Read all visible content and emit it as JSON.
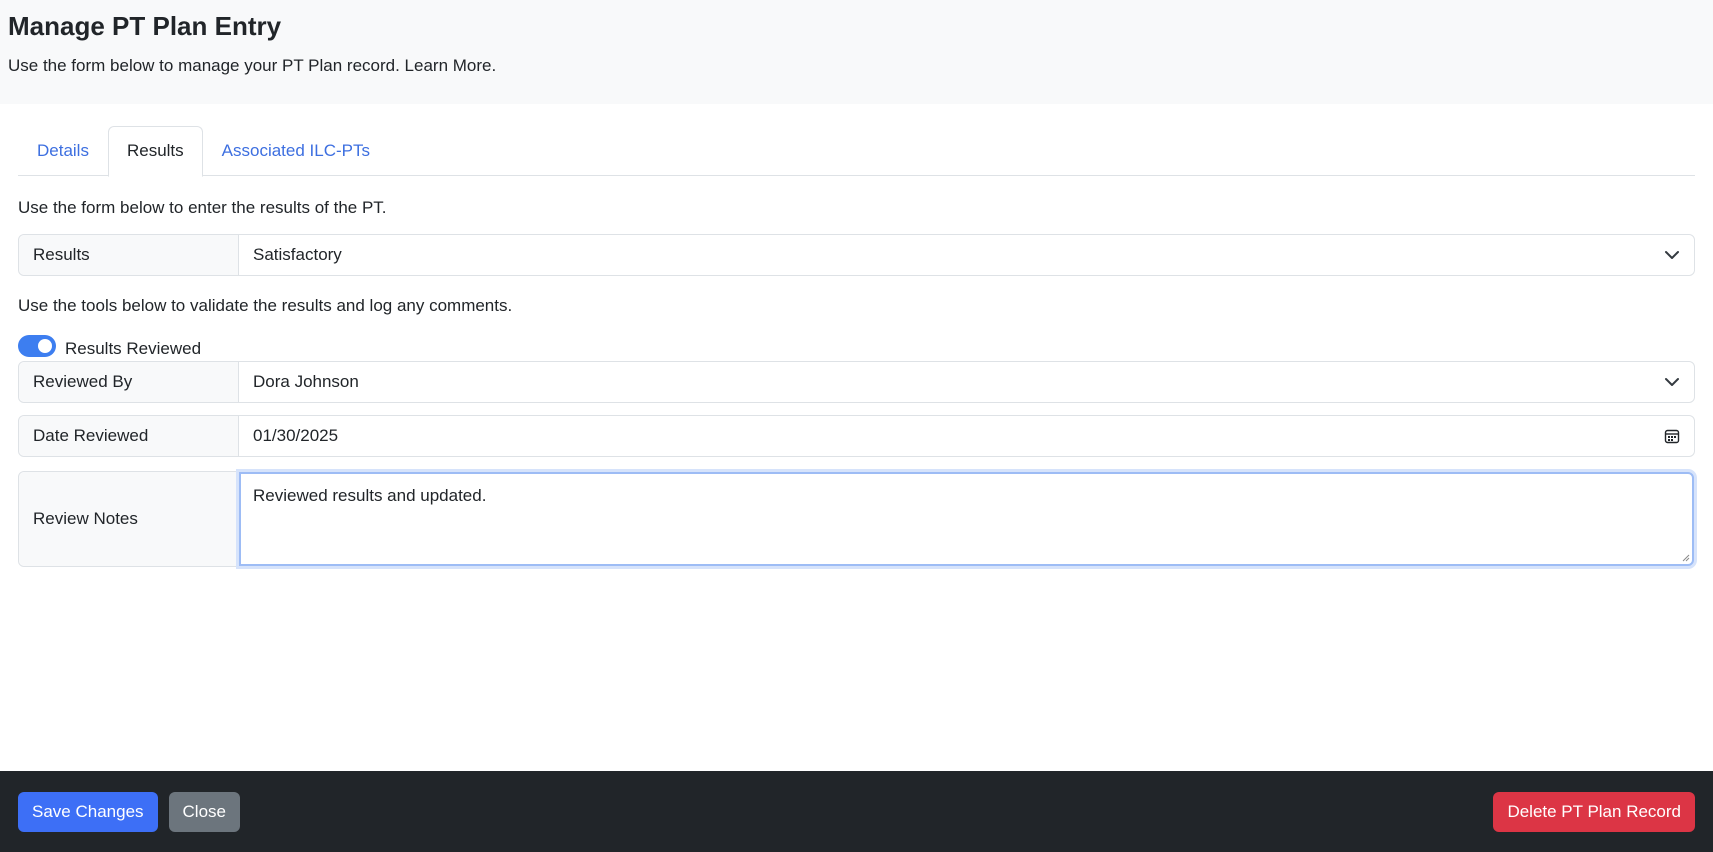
{
  "header": {
    "title": "Manage PT Plan Entry",
    "subtitle": "Use the form below to manage your PT Plan record. Learn More."
  },
  "tabs": [
    {
      "label": "Details",
      "active": false
    },
    {
      "label": "Results",
      "active": true
    },
    {
      "label": "Associated ILC-PTs",
      "active": false
    }
  ],
  "results_section": {
    "helper": "Use the form below to enter the results of the PT.",
    "results_label": "Results",
    "results_value": "Satisfactory"
  },
  "validation_section": {
    "helper": "Use the tools below to validate the results and log any comments.",
    "toggle_label": "Results Reviewed",
    "toggle_on": true,
    "reviewed_by_label": "Reviewed By",
    "reviewed_by_value": "Dora Johnson",
    "date_reviewed_label": "Date Reviewed",
    "date_reviewed_value": "01/30/2025",
    "review_notes_label": "Review Notes",
    "review_notes_value": "Reviewed results and updated."
  },
  "footer": {
    "save_label": "Save Changes",
    "close_label": "Close",
    "delete_label": "Delete PT Plan Record"
  },
  "icons": {
    "select_chevron": "chevron-down-icon",
    "date_picker": "calendar-icon"
  },
  "colors": {
    "link": "#3d6fe0",
    "primary": "#3d6ff6",
    "danger": "#dc3545",
    "secondary": "#6c757d",
    "footer_bg": "#212529",
    "toggle_on": "#3d7ef0"
  }
}
